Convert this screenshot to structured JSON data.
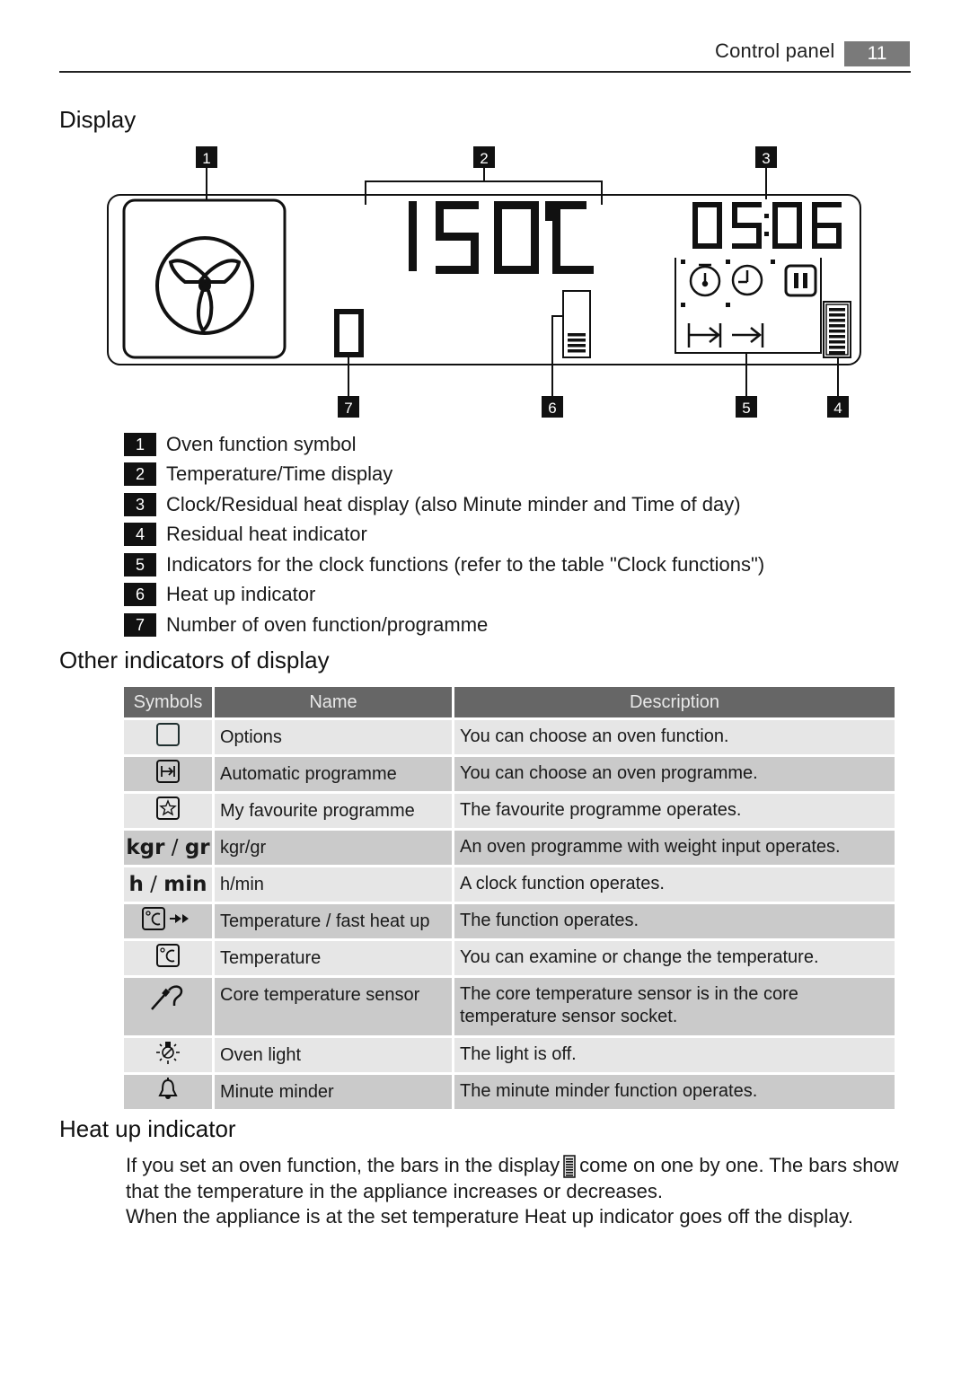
{
  "header": {
    "section_title": "Control panel",
    "page_number": "11"
  },
  "display_section": {
    "title": "Display",
    "diagram": {
      "temperature_readout": "150°C",
      "clock_readout": "05:06",
      "function_number_readout": "0",
      "heat_up_bars_lit": 4,
      "residual_heat_bars_lit": 9,
      "callouts": [
        "1",
        "2",
        "3",
        "4",
        "5",
        "6",
        "7"
      ],
      "icons": [
        "fan-icon",
        "stopwatch-icon",
        "clock-icon",
        "pause-icon",
        "start-time-icon",
        "end-time-icon"
      ]
    },
    "legend": [
      {
        "num": "1",
        "text": "Oven function symbol"
      },
      {
        "num": "2",
        "text": "Temperature/Time display"
      },
      {
        "num": "3",
        "text": "Clock/Residual heat display (also Minute minder and Time of day)"
      },
      {
        "num": "4",
        "text": "Residual heat indicator"
      },
      {
        "num": "5",
        "text": "Indicators for the clock functions (refer to the table \"Clock functions\")"
      },
      {
        "num": "6",
        "text": "Heat up indicator"
      },
      {
        "num": "7",
        "text": "Number of oven function/programme"
      }
    ]
  },
  "indicators_section": {
    "title": "Other indicators of display",
    "columns": [
      "Symbols",
      "Name",
      "Description"
    ],
    "rows": [
      {
        "symbol": "options-box-icon",
        "name": "Options",
        "description": "You can choose an oven function."
      },
      {
        "symbol": "automatic-programme-icon",
        "name": "Automatic programme",
        "description": "You can choose an oven programme."
      },
      {
        "symbol": "favourite-star-icon",
        "name": "My favourite programme",
        "description": "The favourite programme operates."
      },
      {
        "symbol_text_a": "kgr",
        "symbol_sep": " / ",
        "symbol_text_b": "gr",
        "name": "kgr/gr",
        "description": "An oven programme with weight input operates."
      },
      {
        "symbol_text_a": "h",
        "symbol_sep": " / ",
        "symbol_text_b": "min",
        "name": "h/min",
        "description": "A clock function operates."
      },
      {
        "symbol": "temperature-fast-heat-icon",
        "name": "Temperature / fast heat up",
        "description": "The function operates."
      },
      {
        "symbol": "temperature-icon",
        "name": "Temperature",
        "description": "You can examine or change the temperature."
      },
      {
        "symbol": "core-temperature-sensor-icon",
        "name": "Core temperature sensor",
        "description": "The core temperature sensor is in the core temperature sensor socket."
      },
      {
        "symbol": "oven-light-off-icon",
        "name": "Oven light",
        "description": "The light is off."
      },
      {
        "symbol": "bell-icon",
        "name": "Minute minder",
        "description": "The minute minder function operates."
      }
    ]
  },
  "heatup_section": {
    "title": "Heat up indicator",
    "para1_before": "If you set an oven function, the bars in the display",
    "para1_after": "come on one by one. The bars show that the temperature in the appliance increases or decreases.",
    "para2": "When the appliance is at the set temperature Heat up indicator goes off the display."
  },
  "colors": {
    "table_header": "#666666",
    "row_light": "#e6e6e6",
    "row_dark": "#cacaca",
    "page_badge": "#7a7a7a"
  }
}
